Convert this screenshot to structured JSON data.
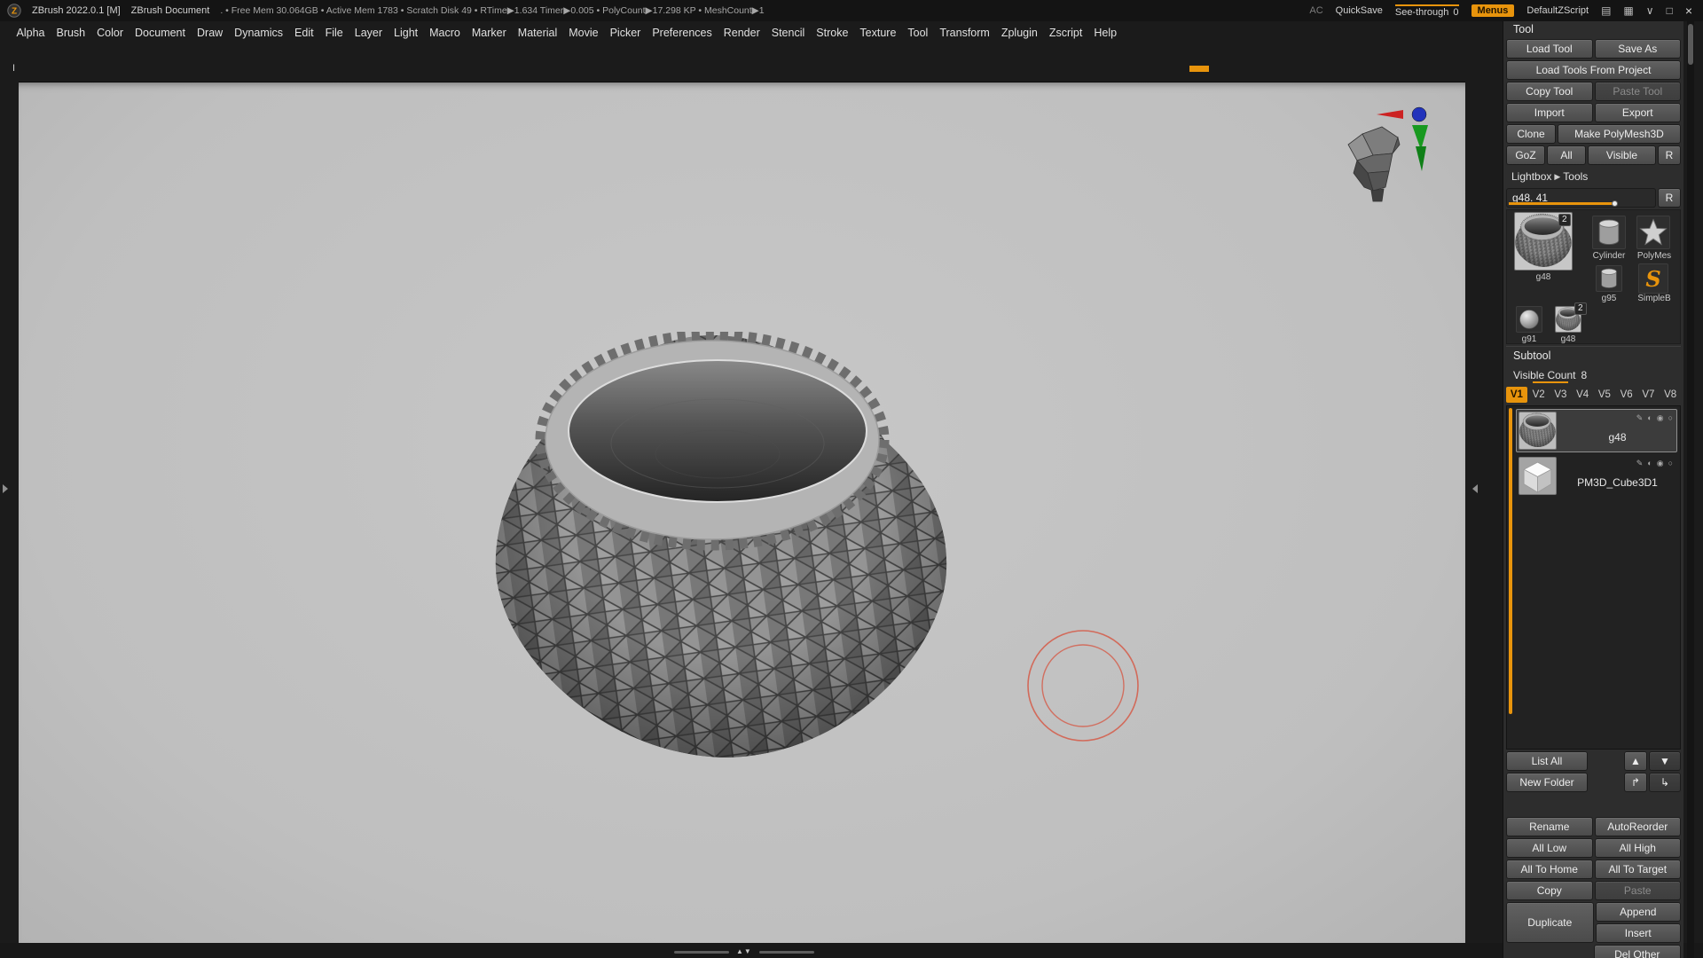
{
  "accent_color": "#e8940c",
  "icons": {
    "window_panel": "▤",
    "window_grid": "▦",
    "window_chevron": "∨",
    "window_restore": "□",
    "window_close": "×",
    "lightbox_arrow": "▶",
    "scrub_arrows": "▲▼",
    "list_up_arrow": "▲",
    "list_down_arrow": "▼",
    "folder_out_arrow": "↱",
    "folder_in_arrow": "↳"
  },
  "title_bar": {
    "app_title": "ZBrush 2022.0.1 [M]",
    "document_title": "ZBrush Document",
    "stats": ". • Free Mem 30.064GB • Active Mem 1783 • Scratch Disk 49 •  RTime▶1.634 Timer▶0.005 • PolyCount▶17.298 KP • MeshCount▶1",
    "ac_label": "AC",
    "quicksave_label": "QuickSave",
    "seethrough_label": "See-through",
    "seethrough_value": "0",
    "menus_label": "Menus",
    "default_zscript_label": "DefaultZScript"
  },
  "menu_bar": {
    "items": [
      "Alpha",
      "Brush",
      "Color",
      "Document",
      "Draw",
      "Dynamics",
      "Edit",
      "File",
      "Layer",
      "Light",
      "Macro",
      "Marker",
      "Material",
      "Movie",
      "Picker",
      "Preferences",
      "Render",
      "Stencil",
      "Stroke",
      "Texture",
      "Tool",
      "Transform",
      "Zplugin",
      "Zscript",
      "Help"
    ]
  },
  "timeline": {
    "marker_label": "I"
  },
  "tool_palette": {
    "title": "Tool",
    "rows": {
      "load_tool": "Load Tool",
      "save_as": "Save As",
      "load_tools_from_project": "Load Tools From Project",
      "copy_tool": "Copy Tool",
      "paste_tool": "Paste Tool",
      "import": "Import",
      "export": "Export",
      "clone": "Clone",
      "make_polymesh3d": "Make PolyMesh3D",
      "goz": "GoZ",
      "all": "All",
      "visible": "Visible",
      "r": "R",
      "lightbox": "Lightbox",
      "tools": "Tools",
      "active_tool": "g48. 41",
      "slider_r": "R"
    },
    "thumbnails": {
      "g48_label": "g48",
      "g48_badge": "2",
      "cylinder_label": "Cylinder",
      "polymesh_label": "PolyMes",
      "g95_label": "g95",
      "simplebrush_label": "SimpleB",
      "simplebrush_glyph": "S",
      "g91_label": "g91",
      "g48_small_label": "g48",
      "g48_small_badge": "2"
    }
  },
  "subtool": {
    "header": "Subtool",
    "visible_count_label": "Visible Count",
    "visible_count_value": "8",
    "tabs": [
      "V1",
      "V2",
      "V3",
      "V4",
      "V5",
      "V6",
      "V7",
      "V8"
    ],
    "items": [
      {
        "name": "g48"
      },
      {
        "name": "PM3D_Cube3D1"
      }
    ],
    "item_icons": [
      "✎",
      "◐",
      "◉",
      "○"
    ],
    "list_all": "List All",
    "new_folder": "New Folder",
    "rename": "Rename",
    "auto_reorder": "AutoReorder",
    "all_low": "All Low",
    "all_high": "All High",
    "all_to_home": "All To Home",
    "all_to_target": "All To Target",
    "copy": "Copy",
    "paste": "Paste",
    "duplicate": "Duplicate",
    "append": "Append",
    "insert": "Insert",
    "del_other": "Del Other"
  }
}
